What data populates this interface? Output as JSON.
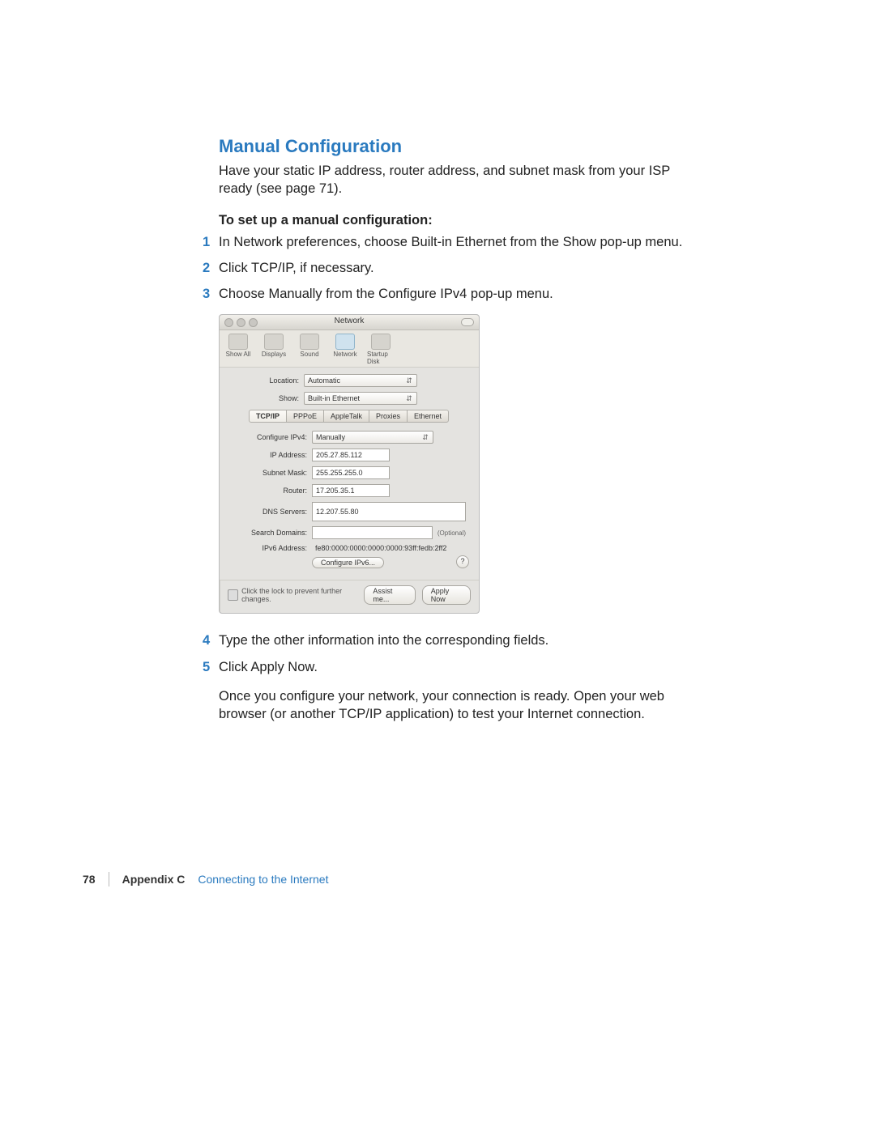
{
  "section_title": "Manual Configuration",
  "intro": "Have your static IP address, router address, and subnet mask from your ISP ready (see page 71).",
  "sub_heading": "To set up a manual configuration:",
  "steps_a": [
    "In Network preferences, choose Built-in Ethernet from the Show pop-up menu.",
    "Click TCP/IP, if necessary.",
    "Choose Manually from the Configure IPv4 pop-up menu."
  ],
  "steps_b": [
    "Type the other information into the corresponding fields.",
    "Click Apply Now."
  ],
  "outro": "Once you configure your network, your connection is ready. Open your web browser (or another TCP/IP application) to test your Internet connection.",
  "panel": {
    "title": "Network",
    "toolbar": {
      "show_all": "Show All",
      "displays": "Displays",
      "sound": "Sound",
      "network": "Network",
      "startup_disk": "Startup Disk"
    },
    "location_label": "Location:",
    "location_value": "Automatic",
    "show_label": "Show:",
    "show_value": "Built-in Ethernet",
    "tabs": {
      "tcpip": "TCP/IP",
      "pppoe": "PPPoE",
      "appletalk": "AppleTalk",
      "proxies": "Proxies",
      "ethernet": "Ethernet"
    },
    "configure_label": "Configure IPv4:",
    "configure_value": "Manually",
    "ip_label": "IP Address:",
    "ip_value": "205.27.85.112",
    "subnet_label": "Subnet Mask:",
    "subnet_value": "255.255.255.0",
    "router_label": "Router:",
    "router_value": "17.205.35.1",
    "dns_label": "DNS Servers:",
    "dns_value": "12.207.55.80",
    "search_label": "Search Domains:",
    "search_value": "",
    "optional": "(Optional)",
    "ipv6_label": "IPv6 Address:",
    "ipv6_value": "fe80:0000:0000:0000:0000:93ff:fedb:2ff2",
    "configure_ipv6": "Configure IPv6...",
    "help": "?",
    "lock_text": "Click the lock to prevent further changes.",
    "assist": "Assist me...",
    "apply": "Apply Now"
  },
  "footer": {
    "page": "78",
    "appendix": "Appendix C",
    "chapter": "Connecting to the Internet"
  }
}
